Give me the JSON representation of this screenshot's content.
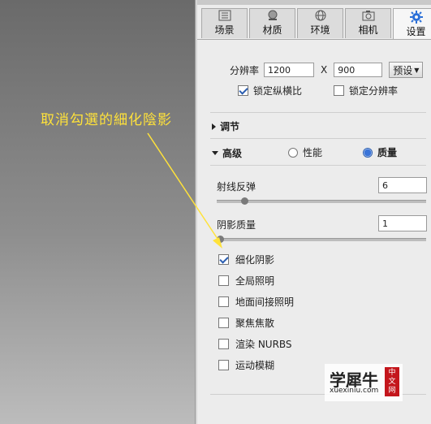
{
  "tabs": [
    {
      "label": "场景",
      "icon": "scene-icon",
      "active": false
    },
    {
      "label": "材质",
      "icon": "material-icon",
      "active": false
    },
    {
      "label": "环境",
      "icon": "environment-icon",
      "active": false
    },
    {
      "label": "相机",
      "icon": "camera-icon",
      "active": false
    },
    {
      "label": "设置",
      "icon": "gear-icon",
      "active": true
    }
  ],
  "resolution": {
    "label": "分辨率",
    "width": "1200",
    "separator": "X",
    "height": "900",
    "preset_label": "预设"
  },
  "lock_aspect": {
    "label": "锁定纵横比",
    "checked": true
  },
  "lock_resolution": {
    "label": "锁定分辨率",
    "checked": false
  },
  "section_adjust": {
    "label": "调节"
  },
  "section_advanced": {
    "label": "高级"
  },
  "mode": {
    "performance_label": "性能",
    "quality_label": "质量",
    "selected": "质量"
  },
  "ray_bounces": {
    "label": "射线反弹",
    "value": "6",
    "slider_fraction": 0.12
  },
  "shadow_quality": {
    "label": "阴影质量",
    "value": "1",
    "slider_fraction": 0.0
  },
  "options": [
    {
      "label": "细化阴影",
      "checked": true
    },
    {
      "label": "全局照明",
      "checked": false
    },
    {
      "label": "地面间接照明",
      "checked": false
    },
    {
      "label": "聚焦焦散",
      "checked": false
    },
    {
      "label": "渲染 NURBS",
      "checked": false
    },
    {
      "label": "运动模糊",
      "checked": false
    }
  ],
  "annotation": {
    "text": "取消勾選的細化陰影",
    "color": "#ffe23a"
  },
  "watermark": {
    "brand": "学犀牛",
    "url": "xuexiniu.com",
    "seal": [
      "中",
      "文",
      "网"
    ]
  },
  "colors": {
    "accent": "#2a5db0",
    "annotation": "#ffe23a"
  }
}
